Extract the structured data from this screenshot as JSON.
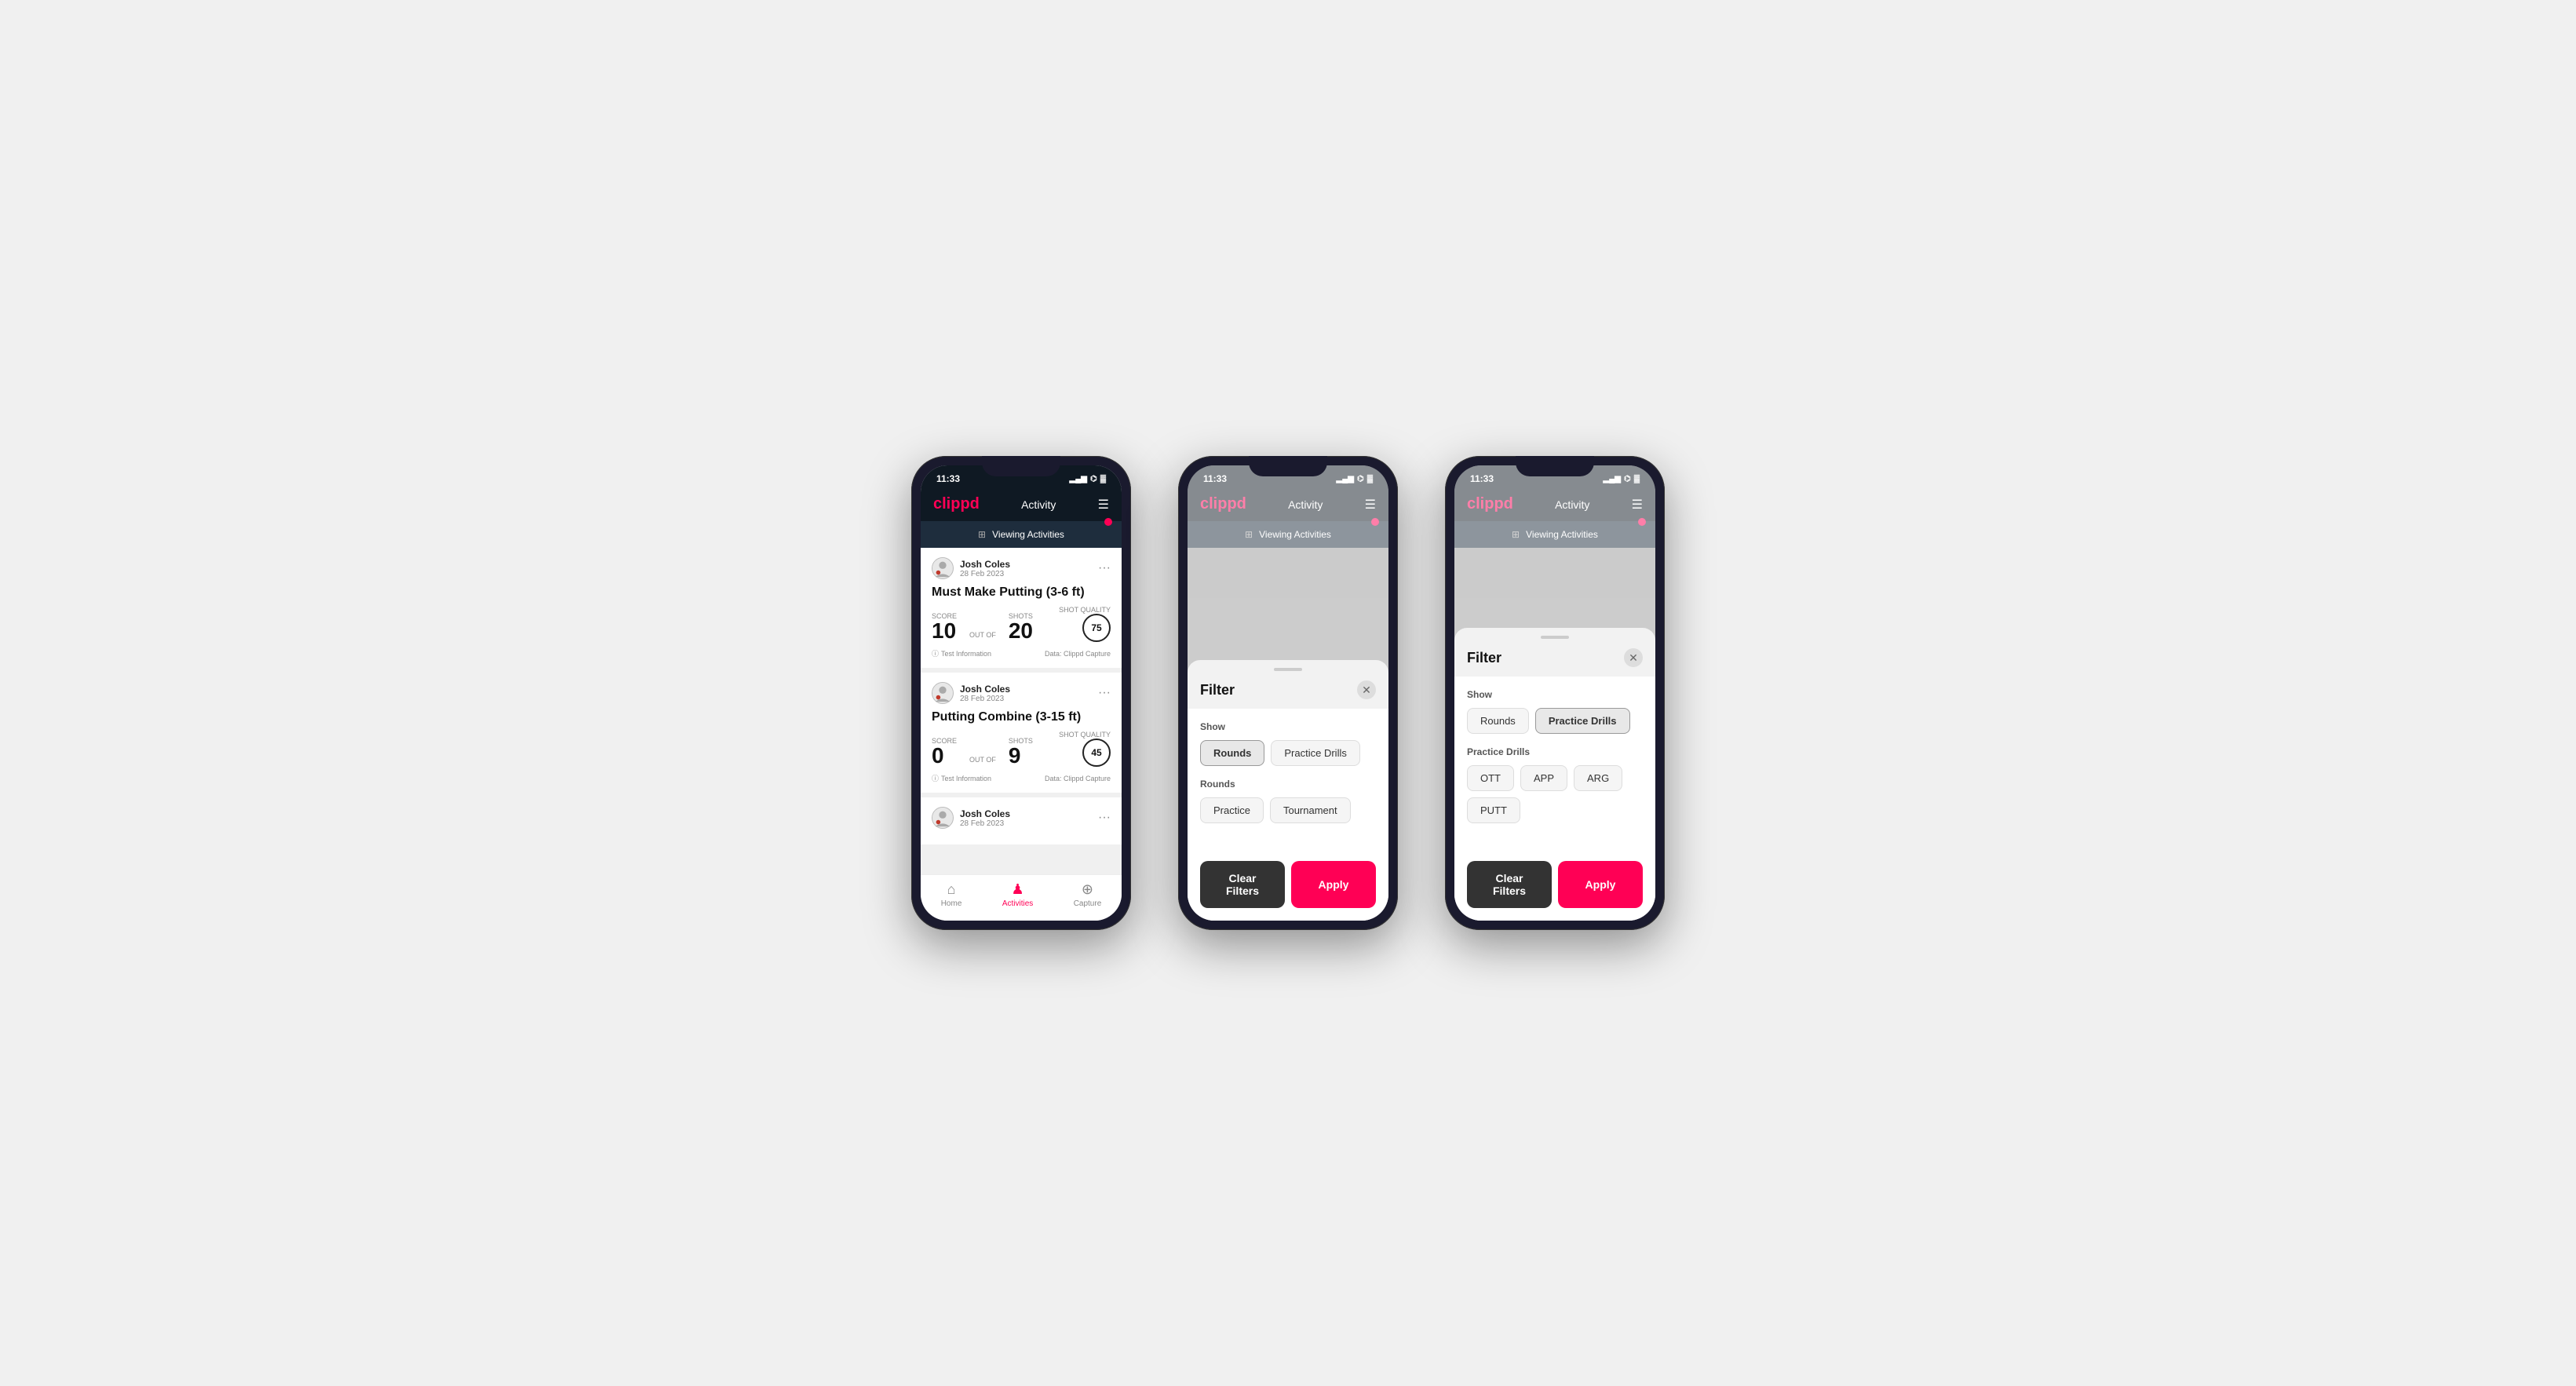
{
  "app": {
    "logo": "clippd",
    "header_title": "Activity",
    "time": "11:33",
    "signal": "▂▄▆",
    "wifi": "WiFi",
    "battery": "31"
  },
  "phone1": {
    "viewing_activities": "Viewing Activities",
    "cards": [
      {
        "user_name": "Josh Coles",
        "user_date": "28 Feb 2023",
        "title": "Must Make Putting (3-6 ft)",
        "score_label": "Score",
        "score_value": "10",
        "outof_label": "OUT OF",
        "shots_label": "Shots",
        "shots_value": "20",
        "shot_quality_label": "Shot Quality",
        "shot_quality_value": "75",
        "test_info": "Test Information",
        "data_source": "Data: Clippd Capture"
      },
      {
        "user_name": "Josh Coles",
        "user_date": "28 Feb 2023",
        "title": "Putting Combine (3-15 ft)",
        "score_label": "Score",
        "score_value": "0",
        "outof_label": "OUT OF",
        "shots_label": "Shots",
        "shots_value": "9",
        "shot_quality_label": "Shot Quality",
        "shot_quality_value": "45",
        "test_info": "Test Information",
        "data_source": "Data: Clippd Capture"
      },
      {
        "user_name": "Josh Coles",
        "user_date": "28 Feb 2023",
        "title": "",
        "score_label": "",
        "score_value": "",
        "outof_label": "",
        "shots_label": "",
        "shots_value": "",
        "shot_quality_label": "",
        "shot_quality_value": "",
        "test_info": "",
        "data_source": ""
      }
    ],
    "nav": {
      "home": "Home",
      "activities": "Activities",
      "capture": "Capture"
    }
  },
  "phone2": {
    "viewing_activities": "Viewing Activities",
    "filter": {
      "title": "Filter",
      "show_label": "Show",
      "rounds_btn": "Rounds",
      "practice_drills_btn": "Practice Drills",
      "rounds_section_label": "Rounds",
      "practice_btn": "Practice",
      "tournament_btn": "Tournament",
      "clear_filters": "Clear Filters",
      "apply": "Apply"
    }
  },
  "phone3": {
    "viewing_activities": "Viewing Activities",
    "filter": {
      "title": "Filter",
      "show_label": "Show",
      "rounds_btn": "Rounds",
      "practice_drills_btn": "Practice Drills",
      "practice_drills_section_label": "Practice Drills",
      "ott_btn": "OTT",
      "app_btn": "APP",
      "arg_btn": "ARG",
      "putt_btn": "PUTT",
      "clear_filters": "Clear Filters",
      "apply": "Apply"
    }
  }
}
